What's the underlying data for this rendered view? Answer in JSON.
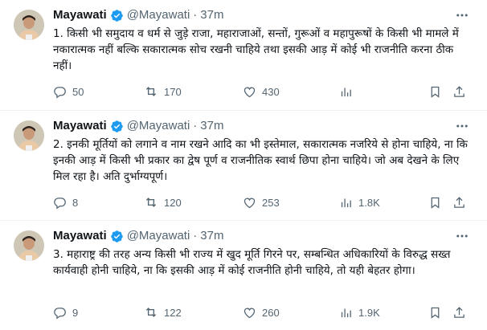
{
  "colors": {
    "text_primary": "#0f1419",
    "text_secondary": "#536471",
    "verified_badge": "#1d9bf0",
    "divider": "#eff3f4"
  },
  "icons": {
    "verified": "verified-badge-icon",
    "more": "more-options-icon",
    "reply": "reply-icon",
    "retweet": "retweet-icon",
    "like": "like-icon",
    "views": "views-icon",
    "bookmark": "bookmark-icon",
    "share": "share-icon"
  },
  "tweets": [
    {
      "name": "Mayawati",
      "handle": "@Mayawati",
      "separator": "·",
      "time": "37m",
      "text": "1. किसी भी समुदाय व धर्म से जुड़े राजा, महाराजाओं, सन्तों, गुरूओं व महापुरूषों के किसी भी मामले में नकारात्मक नहीं बल्कि सकारात्मक सोच रखनी चाहिये तथा इसकी आड़ में कोई भी राजनीति करना ठीक नहीं।",
      "replies": "50",
      "retweets": "170",
      "likes": "430",
      "views": ""
    },
    {
      "name": "Mayawati",
      "handle": "@Mayawati",
      "separator": "·",
      "time": "37m",
      "text": "2. इनकी मूर्तियों को लगाने व नाम रखने आदि का भी इस्तेमाल, सकारात्मक नजरिये से होना चाहिये, ना कि इनकी आड़ में किसी भी प्रकार का द्वेष पूर्ण व राजनीतिक स्वार्थ छिपा होना चाहिये। जो अब देखने के लिए मिल रहा है। अति दुर्भाग्यपूर्ण।",
      "replies": "8",
      "retweets": "120",
      "likes": "253",
      "views": "1.8K"
    },
    {
      "name": "Mayawati",
      "handle": "@Mayawati",
      "separator": "·",
      "time": "37m",
      "text": "3. महाराष्ट्र की तरह अन्य किसी भी राज्य में खुद मूर्ति गिरने पर, सम्बन्धित अधिकारियों के विरुद्ध सख्त कार्यवाही होनी चाहिये, ना कि इसकी आड़ में कोई राजनीति होनी चाहिये, तो यही बेहतर होगा।",
      "replies": "9",
      "retweets": "122",
      "likes": "260",
      "views": "1.9K"
    }
  ]
}
